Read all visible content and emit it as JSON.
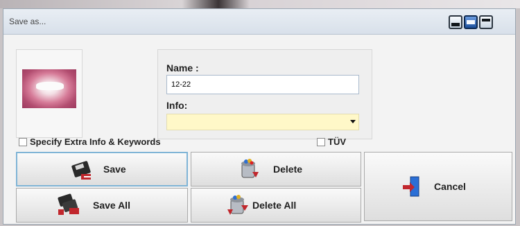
{
  "window": {
    "title": "Save as...",
    "controls": [
      "minimize",
      "maximize",
      "close"
    ]
  },
  "form": {
    "name_label": "Name :",
    "name_value": "12-22",
    "info_label": "Info:",
    "info_value": ""
  },
  "options": {
    "extra_info_label": "Specify Extra Info & Keywords",
    "tuv_label": "TÜV"
  },
  "buttons": {
    "save": "Save",
    "delete": "Delete",
    "cancel": "Cancel",
    "save_all": "Save All",
    "delete_all": "Delete All"
  },
  "colors": {
    "info_bg": "#fff8c8",
    "focus_border": "#7fb4d6",
    "titlebar": "#dfe6ee"
  }
}
